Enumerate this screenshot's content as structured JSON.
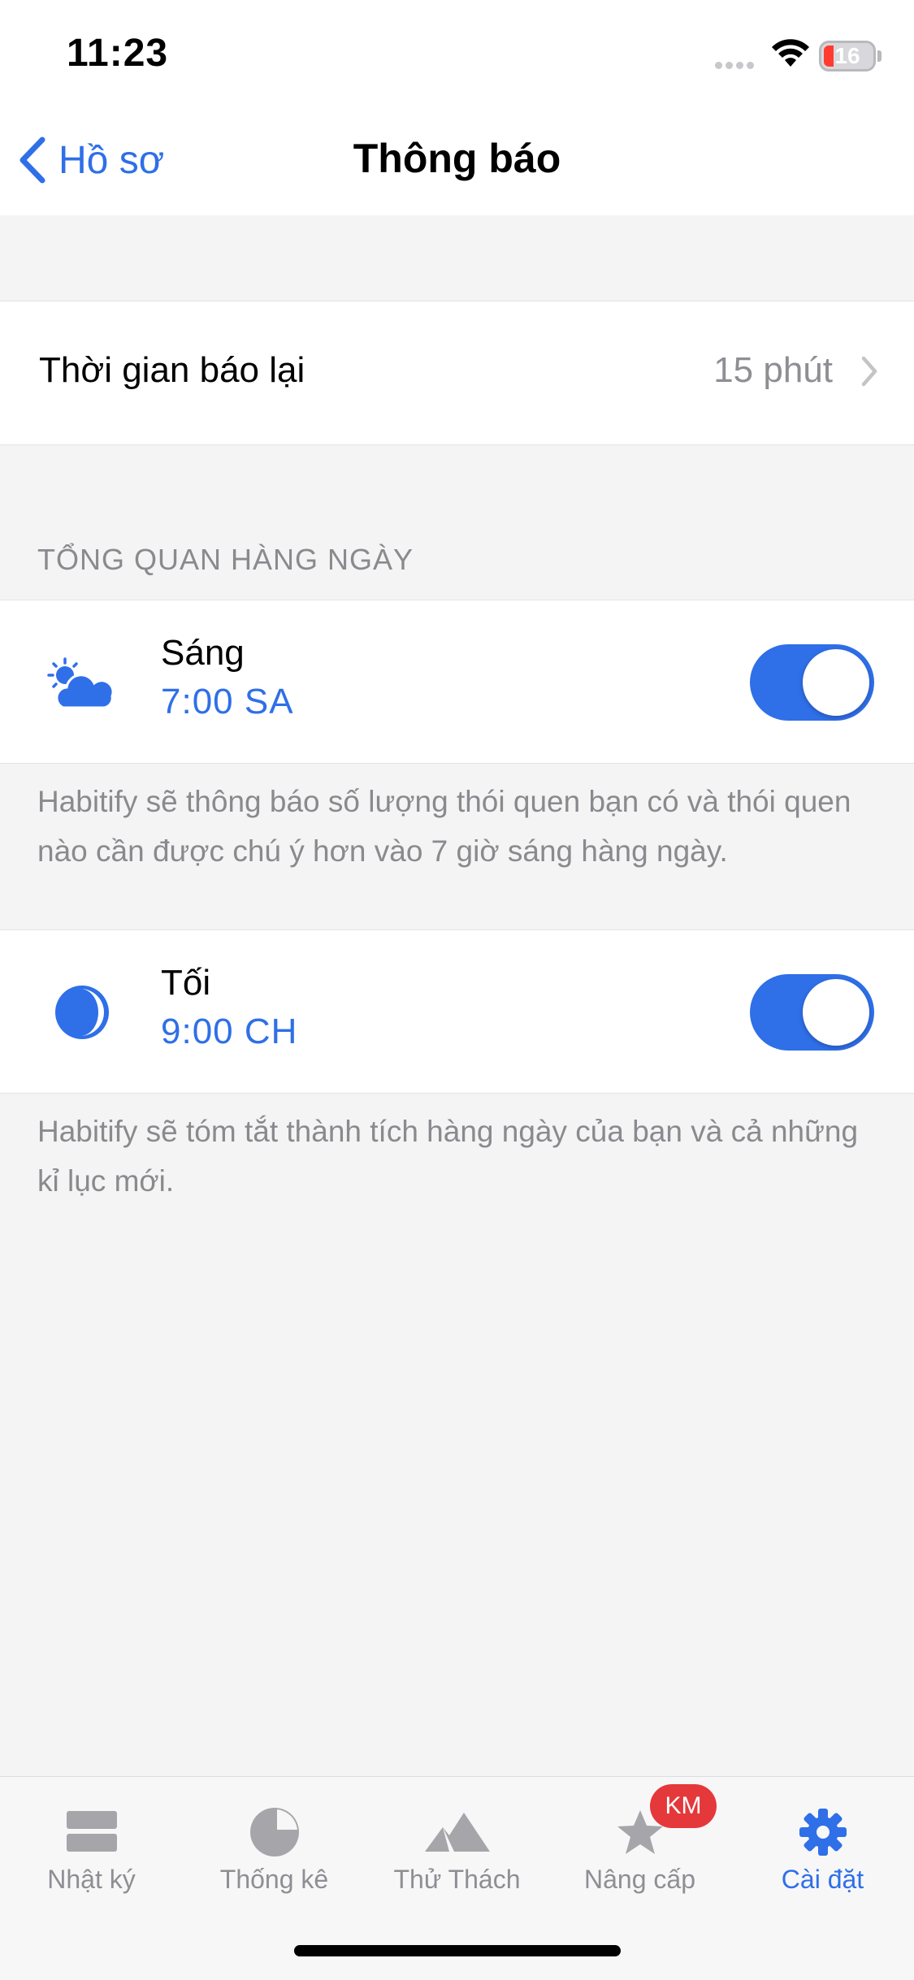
{
  "status_bar": {
    "time": "11:23",
    "battery": "16"
  },
  "nav": {
    "back_label": "Hồ sơ",
    "title": "Thông báo"
  },
  "snooze": {
    "label": "Thời gian báo lại",
    "value": "15 phút"
  },
  "section_header": "TỔNG QUAN HÀNG NGÀY",
  "morning": {
    "title": "Sáng",
    "time": "7:00 SA",
    "enabled": true,
    "description": "Habitify sẽ thông báo số lượng thói quen bạn có và thói quen nào cần được chú ý hơn vào 7 giờ sáng hàng ngày."
  },
  "evening": {
    "title": "Tối",
    "time": "9:00 CH",
    "enabled": true,
    "description": "Habitify sẽ tóm tắt thành tích hàng ngày của bạn và cả những kỉ lục mới."
  },
  "tabs": [
    {
      "label": "Nhật ký",
      "icon": "journal-icon"
    },
    {
      "label": "Thống kê",
      "icon": "pie-chart-icon"
    },
    {
      "label": "Thử Thách",
      "icon": "mountain-icon"
    },
    {
      "label": "Nâng cấp",
      "icon": "star-icon"
    },
    {
      "label": "Cài đặt",
      "icon": "gear-icon",
      "active": true
    }
  ],
  "badge": "KM",
  "colors": {
    "accent": "#2f6fe8",
    "badge": "#e5383b",
    "background": "#f4f4f5"
  }
}
